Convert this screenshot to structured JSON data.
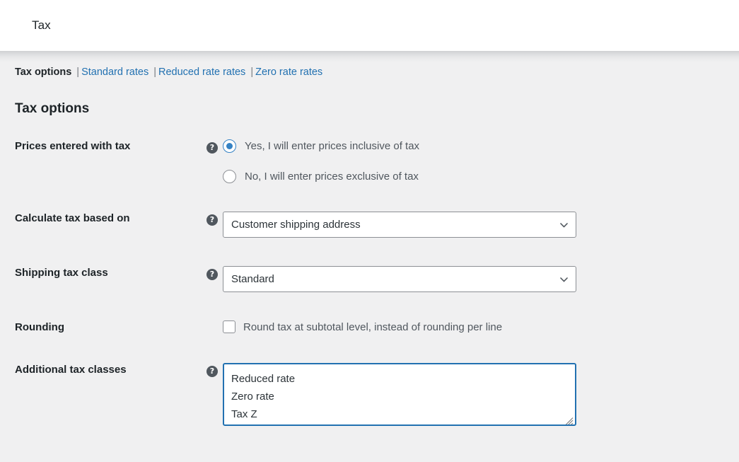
{
  "header": {
    "title": "Tax"
  },
  "subnav": {
    "separator": "|",
    "items": [
      {
        "label": "Tax options",
        "current": true
      },
      {
        "label": "Standard rates",
        "current": false
      },
      {
        "label": "Reduced rate rates",
        "current": false
      },
      {
        "label": "Zero rate rates",
        "current": false
      }
    ]
  },
  "section": {
    "title": "Tax options"
  },
  "help_icon_glyph": "?",
  "rows": {
    "prices_entered_with_tax": {
      "label": "Prices entered with tax",
      "options": [
        {
          "label": "Yes, I will enter prices inclusive of tax",
          "checked": true
        },
        {
          "label": "No, I will enter prices exclusive of tax",
          "checked": false
        }
      ]
    },
    "calculate_tax_based_on": {
      "label": "Calculate tax based on",
      "value": "Customer shipping address"
    },
    "shipping_tax_class": {
      "label": "Shipping tax class",
      "value": "Standard"
    },
    "rounding": {
      "label": "Rounding",
      "checkbox_label": "Round tax at subtotal level, instead of rounding per line",
      "checked": false
    },
    "additional_tax_classes": {
      "label": "Additional tax classes",
      "lines": [
        "Reduced rate",
        "Zero rate",
        "Tax Z"
      ]
    }
  },
  "colors": {
    "accent_blue": "#2271b1",
    "radio_blue": "#3582c4",
    "body_background": "#f0f0f1",
    "label_text": "#1d2327",
    "field_text": "#50575e",
    "border_gray": "#8c8f94"
  }
}
